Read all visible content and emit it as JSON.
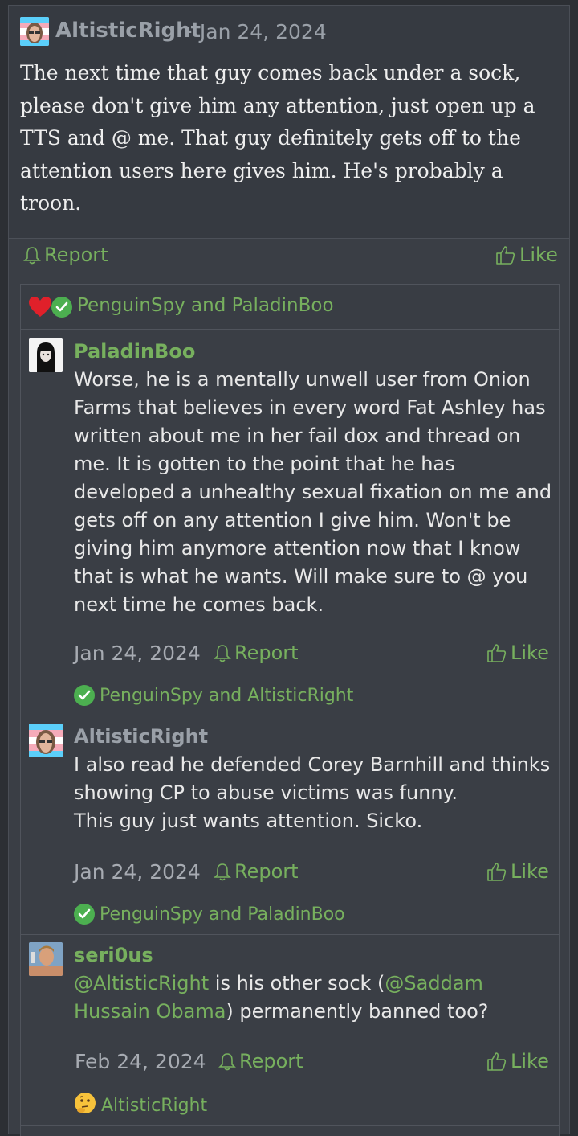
{
  "post": {
    "author": "AltisticRight",
    "separator": "·",
    "date": "Jan 24, 2024",
    "body": "The next time that guy comes back under a sock, please don't give him any attention, just open up a TTS and @ me. That guy definitely gets off to the attention users here gives him. He's probably a troon.",
    "report_label": "Report",
    "like_label": "Like"
  },
  "reactions": {
    "names": "PenguinSpy and PaladinBoo"
  },
  "replies": [
    {
      "author": "PaladinBoo",
      "body": "Worse, he is a mentally unwell user from Onion Farms that believes in every word Fat Ashley has written about me in her fail dox and thread on me. It is gotten to the point that he has developed a unhealthy sexual fixation on me and gets off on any attention I give him. Won't be giving him anymore attention now that I know that is what he wants. Will make sure to @ you next time he comes back.",
      "date": "Jan 24, 2024",
      "report_label": "Report",
      "like_label": "Like",
      "reacted_by": "PenguinSpy and AltisticRight"
    },
    {
      "author": "AltisticRight",
      "body": "I also read he defended Corey Barnhill and thinks showing CP to abuse victims was funny.\nThis guy just wants attention. Sicko.",
      "date": "Jan 24, 2024",
      "report_label": "Report",
      "like_label": "Like",
      "reacted_by": "PenguinSpy and PaladinBoo"
    },
    {
      "author": "seri0us",
      "mention1": "@AltisticRight",
      "text_mid": " is his other sock (",
      "mention2": "@Saddam Hussain Obama",
      "text_end": ") permanently banned too?",
      "date": "Feb 24, 2024",
      "report_label": "Report",
      "like_label": "Like",
      "reacted_by": "AltisticRight"
    }
  ],
  "colors": {
    "accent_green": "#77b05e",
    "background": "#2c2f34",
    "panel": "#3a3e45",
    "heart": "#e0202a",
    "check": "#4caf50"
  },
  "icons": [
    "avatar",
    "bell-icon",
    "thumbs-up-icon",
    "heart-icon",
    "check-icon",
    "thinking-emoji-icon"
  ]
}
